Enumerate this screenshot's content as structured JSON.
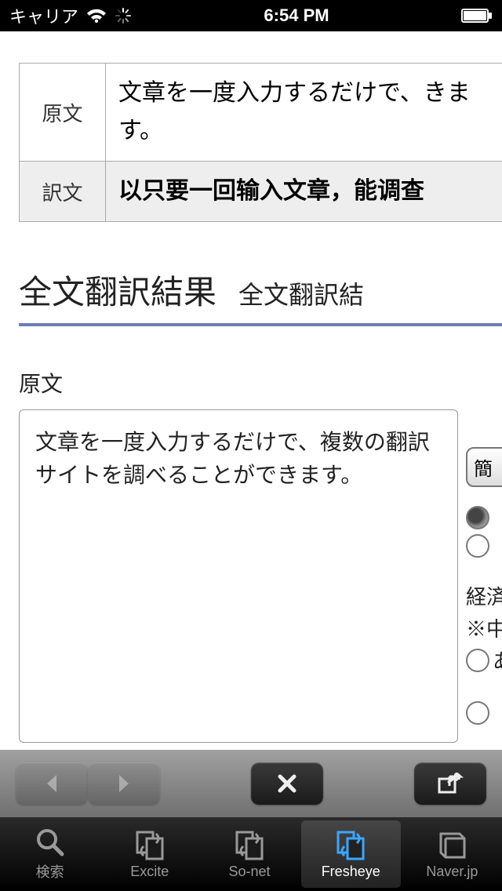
{
  "status": {
    "carrier": "キャリア",
    "time": "6:54 PM"
  },
  "table": {
    "row1_label": "原文",
    "row1_text": "文章を一度入力するだけで、きます。",
    "row2_label": "訳文",
    "row2_text": "以只要一回输入文章，能调查"
  },
  "heading": {
    "main": "全文翻訳結果",
    "sub": "全文翻訳結"
  },
  "origin": {
    "label": "原文",
    "text": "文章を一度入力するだけで、複数の翻訳サイトを調べることができます。"
  },
  "right": {
    "pill": "簡",
    "line1": "経済",
    "line2": "※中",
    "line3": "あ"
  },
  "tabs": {
    "t1": "検索",
    "t2": "Excite",
    "t3": "So-net",
    "t4": "Fresheye",
    "t5": "Naver.jp"
  }
}
